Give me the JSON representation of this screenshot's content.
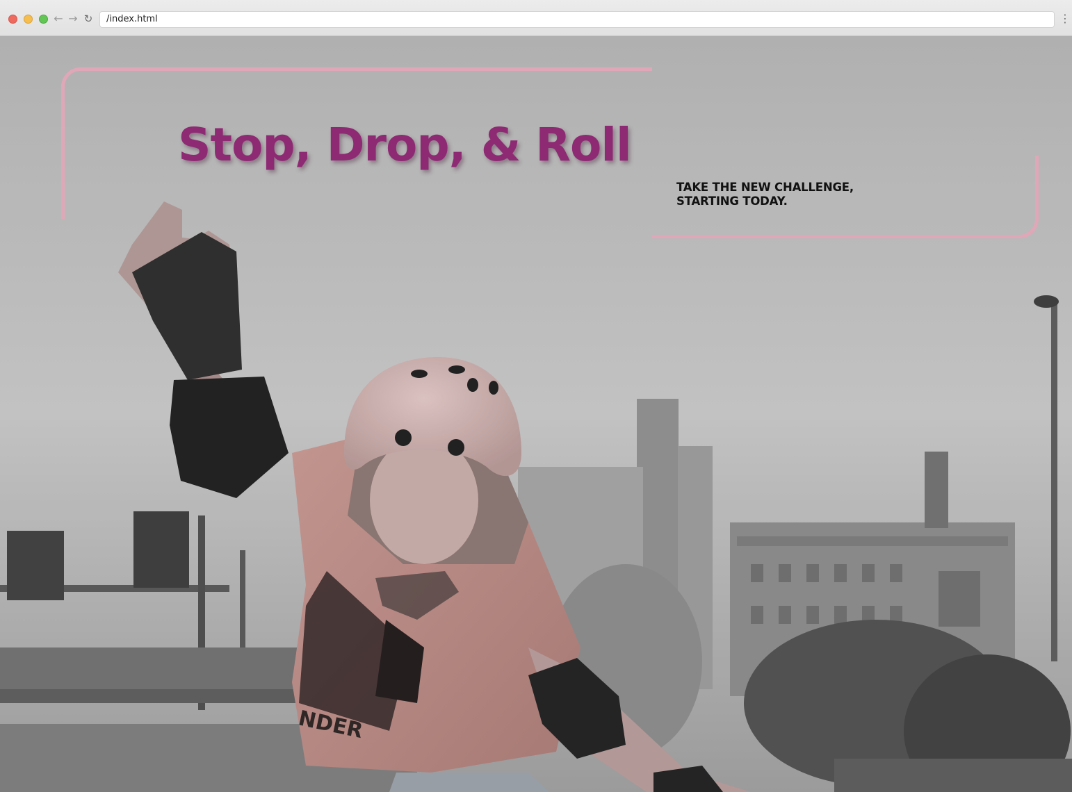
{
  "browser": {
    "url": "/index.html",
    "back_icon": "←",
    "forward_icon": "→",
    "reload_icon": "↻",
    "menu_icon": "⋮"
  },
  "hero": {
    "title": "Stop, Drop, & Roll",
    "tagline_line1": "TAKE THE NEW CHALLENGE,",
    "tagline_line2": "STARTING TODAY.",
    "background_image": "black-and-white photo of roller skater in pink helmet and t-shirt, city buildings behind"
  },
  "colors": {
    "title": "#8e2a73",
    "frame": "#e0a7b8",
    "tagline": "#111111",
    "accent_pink": "#c08a86"
  }
}
